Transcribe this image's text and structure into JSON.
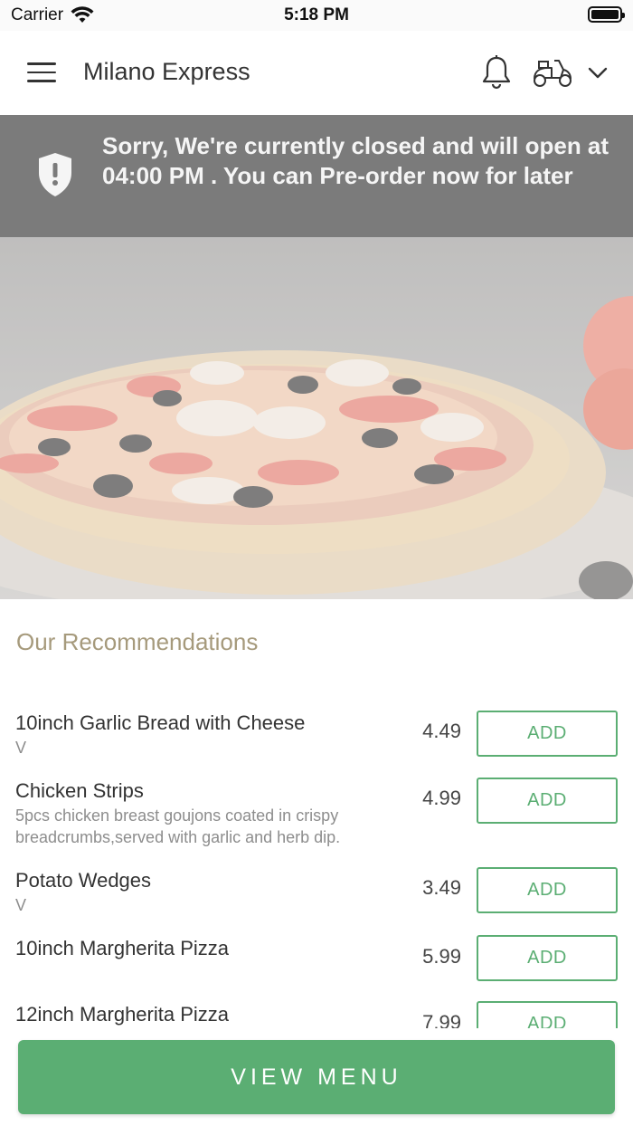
{
  "status_bar": {
    "carrier": "Carrier",
    "time": "5:18 PM"
  },
  "header": {
    "title": "Milano Express",
    "icons": [
      "hamburger-menu-icon",
      "bell-icon",
      "scooter-icon",
      "chevron-down-icon"
    ]
  },
  "banner": {
    "text": "Sorry, We're currently closed and will open at 04:00 PM . You can Pre-order now for later",
    "icon": "shield-alert-icon"
  },
  "recommendations": {
    "title": "Our Recommendations",
    "items": [
      {
        "name": "10inch Garlic Bread with Cheese",
        "desc": "V",
        "price": "4.49",
        "button": "ADD"
      },
      {
        "name": "Chicken Strips",
        "desc": "5pcs chicken breast goujons coated in crispy breadcrumbs,served with garlic and herb dip.",
        "price": "4.99",
        "button": "ADD"
      },
      {
        "name": "Potato Wedges",
        "desc": "V",
        "price": "3.49",
        "button": "ADD"
      },
      {
        "name": "10inch Margherita Pizza",
        "desc": "",
        "price": "5.99",
        "button": "ADD"
      },
      {
        "name": "12inch Margherita Pizza",
        "desc": "",
        "price": "7.99",
        "button": "ADD"
      }
    ]
  },
  "footer": {
    "view_menu_label": "VIEW MENU"
  },
  "colors": {
    "accent_green": "#5bae73",
    "banner_gray": "#7b7b7b",
    "rec_title": "#a69a7c"
  }
}
